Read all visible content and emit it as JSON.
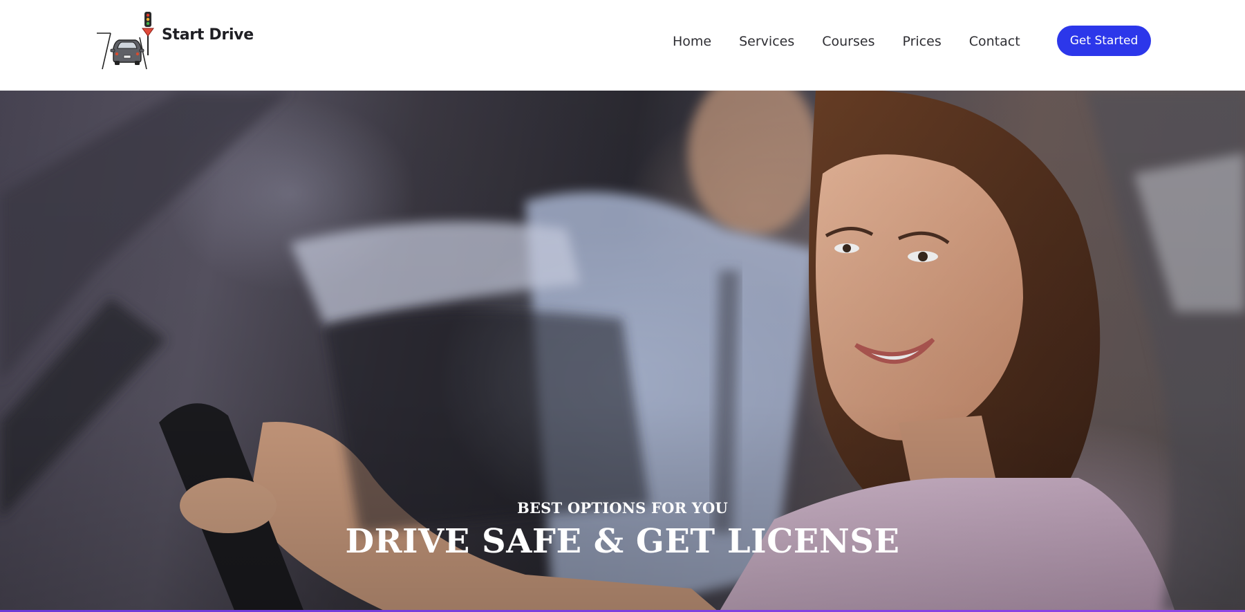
{
  "brand": {
    "name": "Start Drive"
  },
  "nav": {
    "items": [
      {
        "label": "Home"
      },
      {
        "label": "Services"
      },
      {
        "label": "Courses"
      },
      {
        "label": "Prices"
      },
      {
        "label": "Contact"
      }
    ],
    "cta_label": "Get Started"
  },
  "hero": {
    "eyebrow": "BEST OPTIONS FOR YOU",
    "title": "DRIVE SAFE & GET LICENSE"
  },
  "colors": {
    "accent": "#2c37ea",
    "bottom_bar": "#7a3fe0",
    "text_dark": "#1f1f24"
  }
}
